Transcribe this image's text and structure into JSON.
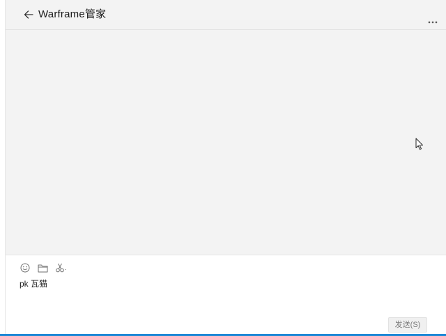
{
  "window": {
    "controls": [
      {
        "name": "pin-icon"
      },
      {
        "name": "minimize-icon"
      },
      {
        "name": "maximize-icon"
      },
      {
        "name": "close-icon"
      }
    ]
  },
  "header": {
    "back_icon": "arrow-left-icon",
    "title": "Warframe管家",
    "more_icon": "more-horizontal-icon"
  },
  "chat": {
    "messages": []
  },
  "composer": {
    "tools": [
      "emoji-icon",
      "folder-icon",
      "scissors-icon"
    ],
    "input_value": "pk 瓦猫",
    "send_label": "发送(S)"
  },
  "colors": {
    "accent": "#1e88d6",
    "background": "#f3f3f3",
    "input_background": "#ffffff"
  }
}
